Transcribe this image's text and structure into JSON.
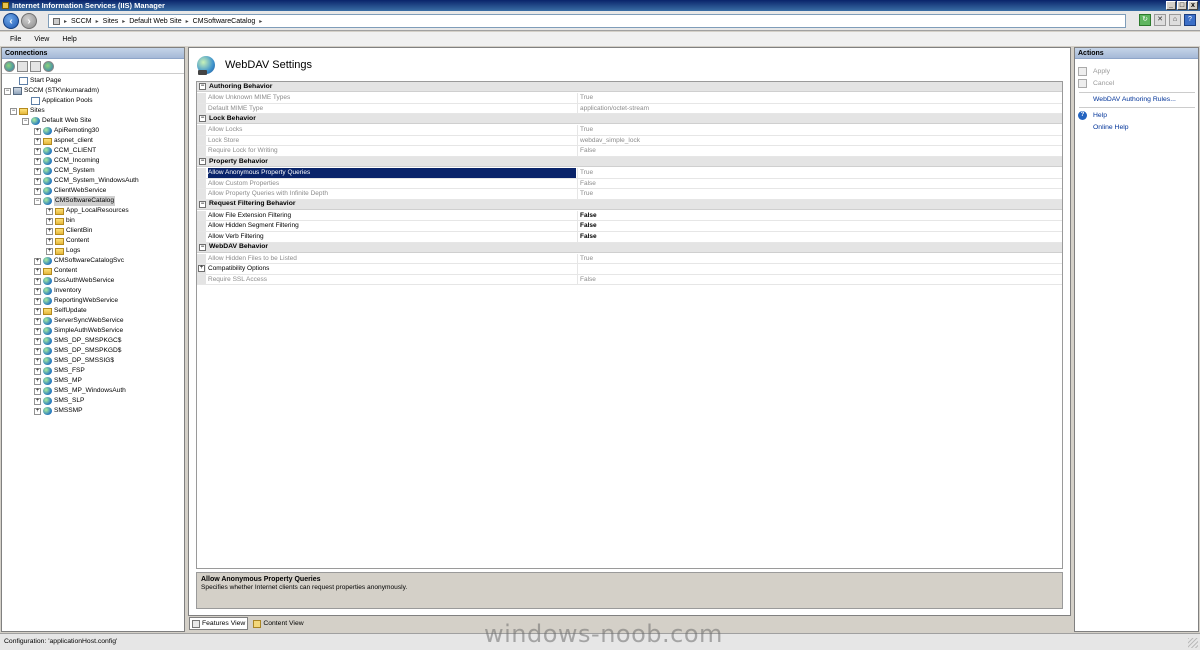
{
  "window": {
    "title": "Internet Information Services (IIS) Manager",
    "buttons": {
      "minimize": "_",
      "maximize": "□",
      "close": "x"
    }
  },
  "address": {
    "crumbs": [
      "SCCM",
      "Sites",
      "Default Web Site",
      "CMSoftwareCatalog"
    ],
    "separator": "▸"
  },
  "menu": {
    "file": "File",
    "view": "View",
    "help": "Help"
  },
  "connections": {
    "header": "Connections",
    "tree": [
      {
        "label": "Start Page",
        "icon": "page",
        "level": 1,
        "exp": ""
      },
      {
        "label": "SCCM (STK\\nkumaradm)",
        "icon": "server",
        "level": 0,
        "exp": "−"
      },
      {
        "label": "Application Pools",
        "icon": "page",
        "level": 2,
        "exp": ""
      },
      {
        "label": "Sites",
        "icon": "folder",
        "level": 1,
        "exp": "−"
      },
      {
        "label": "Default Web Site",
        "icon": "globe",
        "level": 2,
        "exp": "−"
      },
      {
        "label": "ApiRemoting30",
        "icon": "globe",
        "level": 3,
        "exp": "+"
      },
      {
        "label": "aspnet_client",
        "icon": "folder",
        "level": 3,
        "exp": "+"
      },
      {
        "label": "CCM_CLIENT",
        "icon": "globe",
        "level": 3,
        "exp": "+"
      },
      {
        "label": "CCM_Incoming",
        "icon": "globe",
        "level": 3,
        "exp": "+"
      },
      {
        "label": "CCM_System",
        "icon": "globe",
        "level": 3,
        "exp": "+"
      },
      {
        "label": "CCM_System_WindowsAuth",
        "icon": "globe",
        "level": 3,
        "exp": "+"
      },
      {
        "label": "ClientWebService",
        "icon": "globe",
        "level": 3,
        "exp": "+"
      },
      {
        "label": "CMSoftwareCatalog",
        "icon": "globe",
        "level": 3,
        "exp": "−",
        "selected": true
      },
      {
        "label": "App_LocalResources",
        "icon": "folder",
        "level": 4,
        "exp": "+"
      },
      {
        "label": "bin",
        "icon": "folder",
        "level": 4,
        "exp": "+"
      },
      {
        "label": "ClientBin",
        "icon": "folder",
        "level": 4,
        "exp": "+"
      },
      {
        "label": "Content",
        "icon": "folder",
        "level": 4,
        "exp": "+"
      },
      {
        "label": "Logs",
        "icon": "folder",
        "level": 4,
        "exp": "+"
      },
      {
        "label": "CMSoftwareCatalogSvc",
        "icon": "globe",
        "level": 3,
        "exp": "+"
      },
      {
        "label": "Content",
        "icon": "folder",
        "level": 3,
        "exp": "+"
      },
      {
        "label": "DssAuthWebService",
        "icon": "globe",
        "level": 3,
        "exp": "+"
      },
      {
        "label": "Inventory",
        "icon": "globe",
        "level": 3,
        "exp": "+"
      },
      {
        "label": "ReportingWebService",
        "icon": "globe",
        "level": 3,
        "exp": "+"
      },
      {
        "label": "SelfUpdate",
        "icon": "folder",
        "level": 3,
        "exp": "+"
      },
      {
        "label": "ServerSyncWebService",
        "icon": "globe",
        "level": 3,
        "exp": "+"
      },
      {
        "label": "SimpleAuthWebService",
        "icon": "globe",
        "level": 3,
        "exp": "+"
      },
      {
        "label": "SMS_DP_SMSPKGC$",
        "icon": "globe",
        "level": 3,
        "exp": "+"
      },
      {
        "label": "SMS_DP_SMSPKGD$",
        "icon": "globe",
        "level": 3,
        "exp": "+"
      },
      {
        "label": "SMS_DP_SMSSIG$",
        "icon": "globe",
        "level": 3,
        "exp": "+"
      },
      {
        "label": "SMS_FSP",
        "icon": "globe",
        "level": 3,
        "exp": "+"
      },
      {
        "label": "SMS_MP",
        "icon": "globe",
        "level": 3,
        "exp": "+"
      },
      {
        "label": "SMS_MP_WindowsAuth",
        "icon": "globe",
        "level": 3,
        "exp": "+"
      },
      {
        "label": "SMS_SLP",
        "icon": "globe",
        "level": 3,
        "exp": "+"
      },
      {
        "label": "SMSSMP",
        "icon": "globe",
        "level": 3,
        "exp": "+"
      }
    ]
  },
  "main": {
    "title": "WebDAV Settings",
    "categories": [
      {
        "name": "Authoring Behavior",
        "rows": [
          {
            "name": "Allow Unknown MIME Types",
            "value": "True",
            "enabled": false
          },
          {
            "name": "Default MIME Type",
            "value": "application/octet-stream",
            "enabled": false
          }
        ]
      },
      {
        "name": "Lock Behavior",
        "rows": [
          {
            "name": "Allow Locks",
            "value": "True",
            "enabled": false
          },
          {
            "name": "Lock Store",
            "value": "webdav_simple_lock",
            "enabled": false
          },
          {
            "name": "Require Lock for Writing",
            "value": "False",
            "enabled": false
          }
        ]
      },
      {
        "name": "Property Behavior",
        "rows": [
          {
            "name": "Allow Anonymous Property Queries",
            "value": "True",
            "enabled": false,
            "selected": true
          },
          {
            "name": "Allow Custom Properties",
            "value": "False",
            "enabled": false
          },
          {
            "name": "Allow Property Queries with Infinite Depth",
            "value": "True",
            "enabled": false
          }
        ]
      },
      {
        "name": "Request Filtering Behavior",
        "rows": [
          {
            "name": "Allow File Extension Filtering",
            "value": "False",
            "enabled": true
          },
          {
            "name": "Allow Hidden Segment Filtering",
            "value": "False",
            "enabled": true
          },
          {
            "name": "Allow Verb Filtering",
            "value": "False",
            "enabled": true
          }
        ]
      },
      {
        "name": "WebDAV Behavior",
        "rows": [
          {
            "name": "Allow Hidden Files to be Listed",
            "value": "True",
            "enabled": false
          },
          {
            "name": "Compatibility Options",
            "value": "",
            "enabled": false,
            "compat": true
          },
          {
            "name": "Require SSL Access",
            "value": "False",
            "enabled": false
          }
        ]
      }
    ],
    "description": {
      "title": "Allow Anonymous Property Queries",
      "text": "Specifies whether Internet clients can request properties anonymously."
    }
  },
  "view_tabs": {
    "features": "Features View",
    "content": "Content View"
  },
  "actions": {
    "header": "Actions",
    "apply": "Apply",
    "cancel": "Cancel",
    "authoring_rules": "WebDAV Authoring Rules...",
    "help": "Help",
    "online_help": "Online Help"
  },
  "status": {
    "text": "Configuration: 'applicationHost.config'"
  },
  "watermark": "windows-noob.com"
}
